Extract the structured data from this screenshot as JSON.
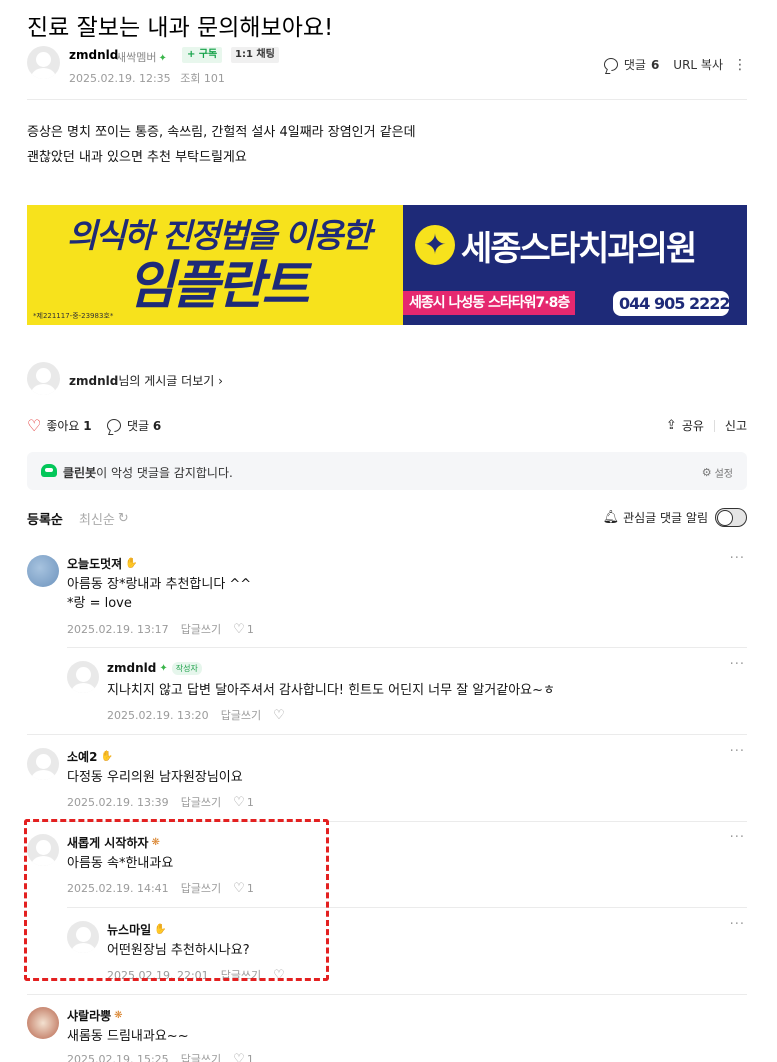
{
  "post": {
    "title": "진료 잘보는 내과 문의해보아요!",
    "author": "zmdnld",
    "author_level": "새싹멤버",
    "subscribe_label": "+ 구독",
    "chat_label": "1:1 채팅",
    "date": "2025.02.19. 12:35",
    "views_label": "조회 101",
    "comment_label": "댓글",
    "comment_count": "6",
    "url_copy_label": "URL 복사",
    "body_line1": "증상은 명치 쪼이는 통증, 속쓰림, 간헐적 설사 4일째라 장염인거 같은데",
    "body_line2": "괜찮았던 내과 있으면 추천 부탁드릴게요"
  },
  "ad": {
    "slogan": "의식하 진정법을 이용한",
    "main": "임플란트",
    "code": "*제221117-중-23983호*",
    "clinic": "세종스타치과의원",
    "address": "세종시 나성동 스타타워7·8층",
    "phone": "044 905 2222",
    "colors": {
      "yellow": "#f7e21c",
      "navy": "#1e2a78",
      "pink": "#e5286f"
    }
  },
  "more_posts": {
    "author": "zmdnld",
    "suffix": "님의 게시글 더보기 ›"
  },
  "action_bar": {
    "like_label": "좋아요",
    "like_count": "1",
    "comment_label": "댓글",
    "comment_count": "6",
    "share_label": "공유",
    "report_label": "신고"
  },
  "cleanbot": {
    "name": "클린봇",
    "text": "이 악성 댓글을 감지합니다.",
    "settings_label": "설정"
  },
  "sort": {
    "registered": "등록순",
    "latest": "최신순",
    "alarm_label": "관심글 댓글 알림"
  },
  "comments": [
    {
      "name": "오늘도멋져",
      "badge": "✋",
      "text1": "아름동 장*랑내과 추천합니다 ^^",
      "text2": "*랑 = love",
      "date": "2025.02.19. 13:17",
      "reply": "답글쓰기",
      "likes": "1"
    },
    {
      "name": "zmdnld",
      "writer": "작성자",
      "text1": "지나치지 않고 답변 달아주셔서 감사합니다! 힌트도 어딘지 너무 잘 알거같아요~ㅎ",
      "date": "2025.02.19. 13:20",
      "reply": "답글쓰기"
    },
    {
      "name": "소예2",
      "badge": "✋",
      "text1": "다정동 우리의원 남자원장님이요",
      "date": "2025.02.19. 13:39",
      "reply": "답글쓰기",
      "likes": "1"
    },
    {
      "name": "새롭게 시작하자",
      "badge": "❋",
      "text1": "아름동 속*한내과요",
      "date": "2025.02.19. 14:41",
      "reply": "답글쓰기",
      "likes": "1"
    },
    {
      "name": "뉴스마일",
      "badge": "✋",
      "text1": "어떤원장님 추천하시나요?",
      "date": "2025.02.19. 22:01",
      "reply": "답글쓰기"
    },
    {
      "name": "샤랄라뿡",
      "badge": "❋",
      "text1": "새롬동 드림내과요~~",
      "date": "2025.02.19. 15:25",
      "reply": "답글쓰기",
      "likes": "1"
    }
  ]
}
